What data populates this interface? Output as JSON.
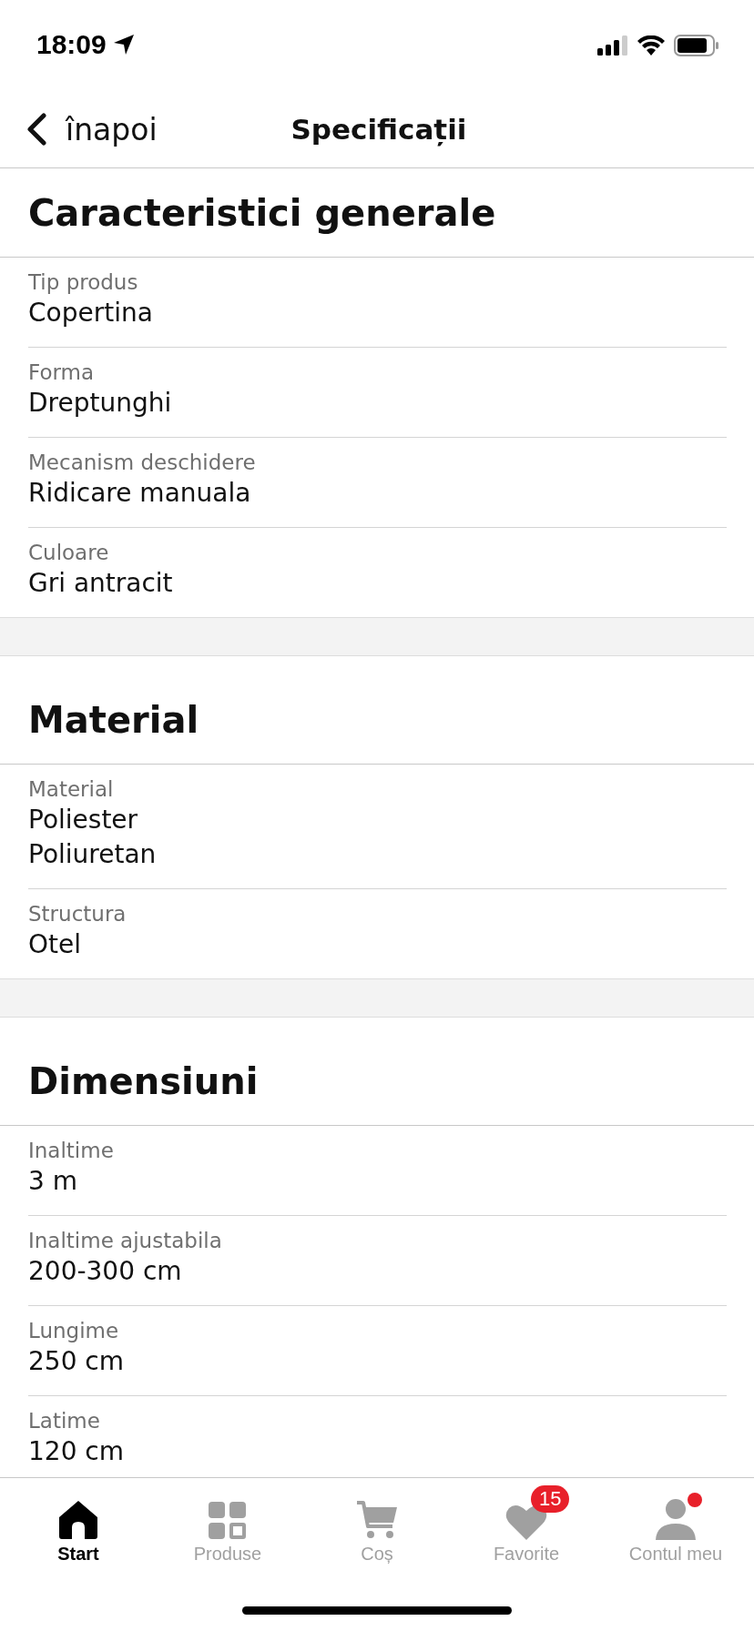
{
  "status_bar": {
    "time": "18:09"
  },
  "header": {
    "back_label": "înapoi",
    "title": "Specificații"
  },
  "sections": [
    {
      "title": "Caracteristici generale",
      "rows": [
        {
          "label": "Tip produs",
          "values": [
            "Copertina"
          ]
        },
        {
          "label": "Forma",
          "values": [
            "Dreptunghi"
          ]
        },
        {
          "label": "Mecanism deschidere",
          "values": [
            "Ridicare manuala"
          ]
        },
        {
          "label": "Culoare",
          "values": [
            "Gri antracit"
          ]
        }
      ]
    },
    {
      "title": "Material",
      "rows": [
        {
          "label": "Material",
          "values": [
            "Poliester",
            "Poliuretan"
          ]
        },
        {
          "label": "Structura",
          "values": [
            "Otel"
          ]
        }
      ]
    },
    {
      "title": "Dimensiuni",
      "rows": [
        {
          "label": "Inaltime",
          "values": [
            "3 m"
          ]
        },
        {
          "label": "Inaltime ajustabila",
          "values": [
            "200-300 cm"
          ]
        },
        {
          "label": "Lungime",
          "values": [
            "250 cm"
          ]
        },
        {
          "label": "Latime",
          "values": [
            "120 cm"
          ]
        }
      ]
    }
  ],
  "tab_bar": [
    {
      "label": "Start",
      "selected": true
    },
    {
      "label": "Produse",
      "selected": false
    },
    {
      "label": "Coș",
      "selected": false
    },
    {
      "label": "Favorite",
      "selected": false,
      "badge": "15"
    },
    {
      "label": "Contul meu",
      "selected": false,
      "dot": true
    }
  ]
}
